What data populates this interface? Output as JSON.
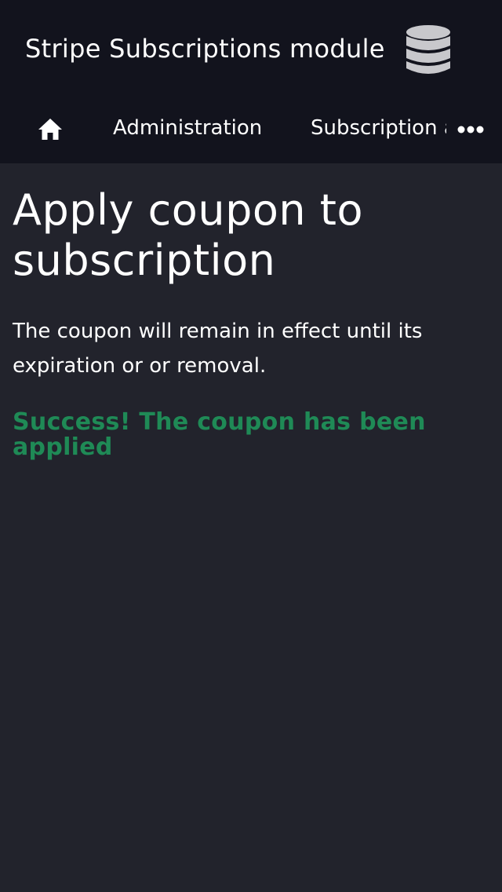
{
  "header": {
    "title": "Stripe Subscriptions module",
    "icon": "database-icon"
  },
  "nav": {
    "home_icon": "home-icon",
    "items": [
      {
        "label": "Administration"
      },
      {
        "label": "Subscription a"
      }
    ],
    "more_icon": "ellipsis-icon"
  },
  "main": {
    "title": "Apply coupon to subscription",
    "description": "The coupon will remain in effect until its expiration or or removal.",
    "success_message": "Success! The coupon has been applied"
  },
  "colors": {
    "header_bg": "#12131d",
    "page_bg": "#22232c",
    "success": "#1f8a56",
    "icon_gray": "#c8c8cc"
  }
}
